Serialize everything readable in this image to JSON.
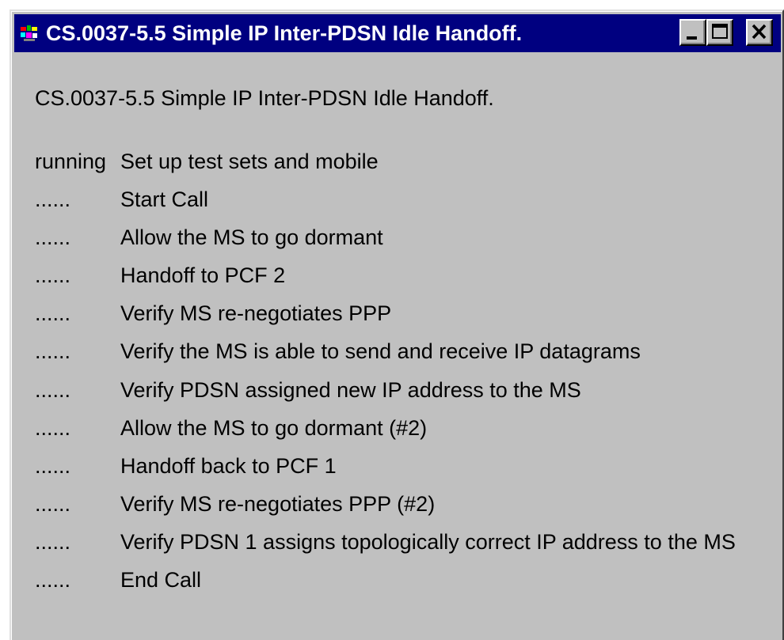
{
  "window": {
    "title": "CS.0037-5.5 Simple IP Inter-PDSN Idle Handoff.",
    "icon": "app-icon",
    "buttons": [
      "minimize",
      "maximize",
      "close"
    ]
  },
  "heading": "CS.0037-5.5 Simple IP Inter-PDSN Idle Handoff.",
  "steps": [
    {
      "status": "running",
      "label": "Set up test sets and mobile"
    },
    {
      "status": "......",
      "label": "Start Call"
    },
    {
      "status": "......",
      "label": "Allow the MS to go dormant"
    },
    {
      "status": "......",
      "label": "Handoff to PCF 2"
    },
    {
      "status": "......",
      "label": "Verify MS re-negotiates PPP"
    },
    {
      "status": "......",
      "label": "Verify the MS is able to send and receive IP datagrams"
    },
    {
      "status": "......",
      "label": "Verify PDSN assigned new IP address to the MS"
    },
    {
      "status": "......",
      "label": "Allow the MS to go dormant (#2)"
    },
    {
      "status": "......",
      "label": "Handoff back to PCF 1"
    },
    {
      "status": "......",
      "label": "Verify MS re-negotiates PPP (#2)"
    },
    {
      "status": "......",
      "label": "Verify PDSN 1 assigns topologically correct IP address to the MS"
    },
    {
      "status": "......",
      "label": "End Call"
    }
  ],
  "colors": {
    "titlebar": "#000080",
    "window_bg": "#c0c0c0",
    "text": "#000000"
  }
}
